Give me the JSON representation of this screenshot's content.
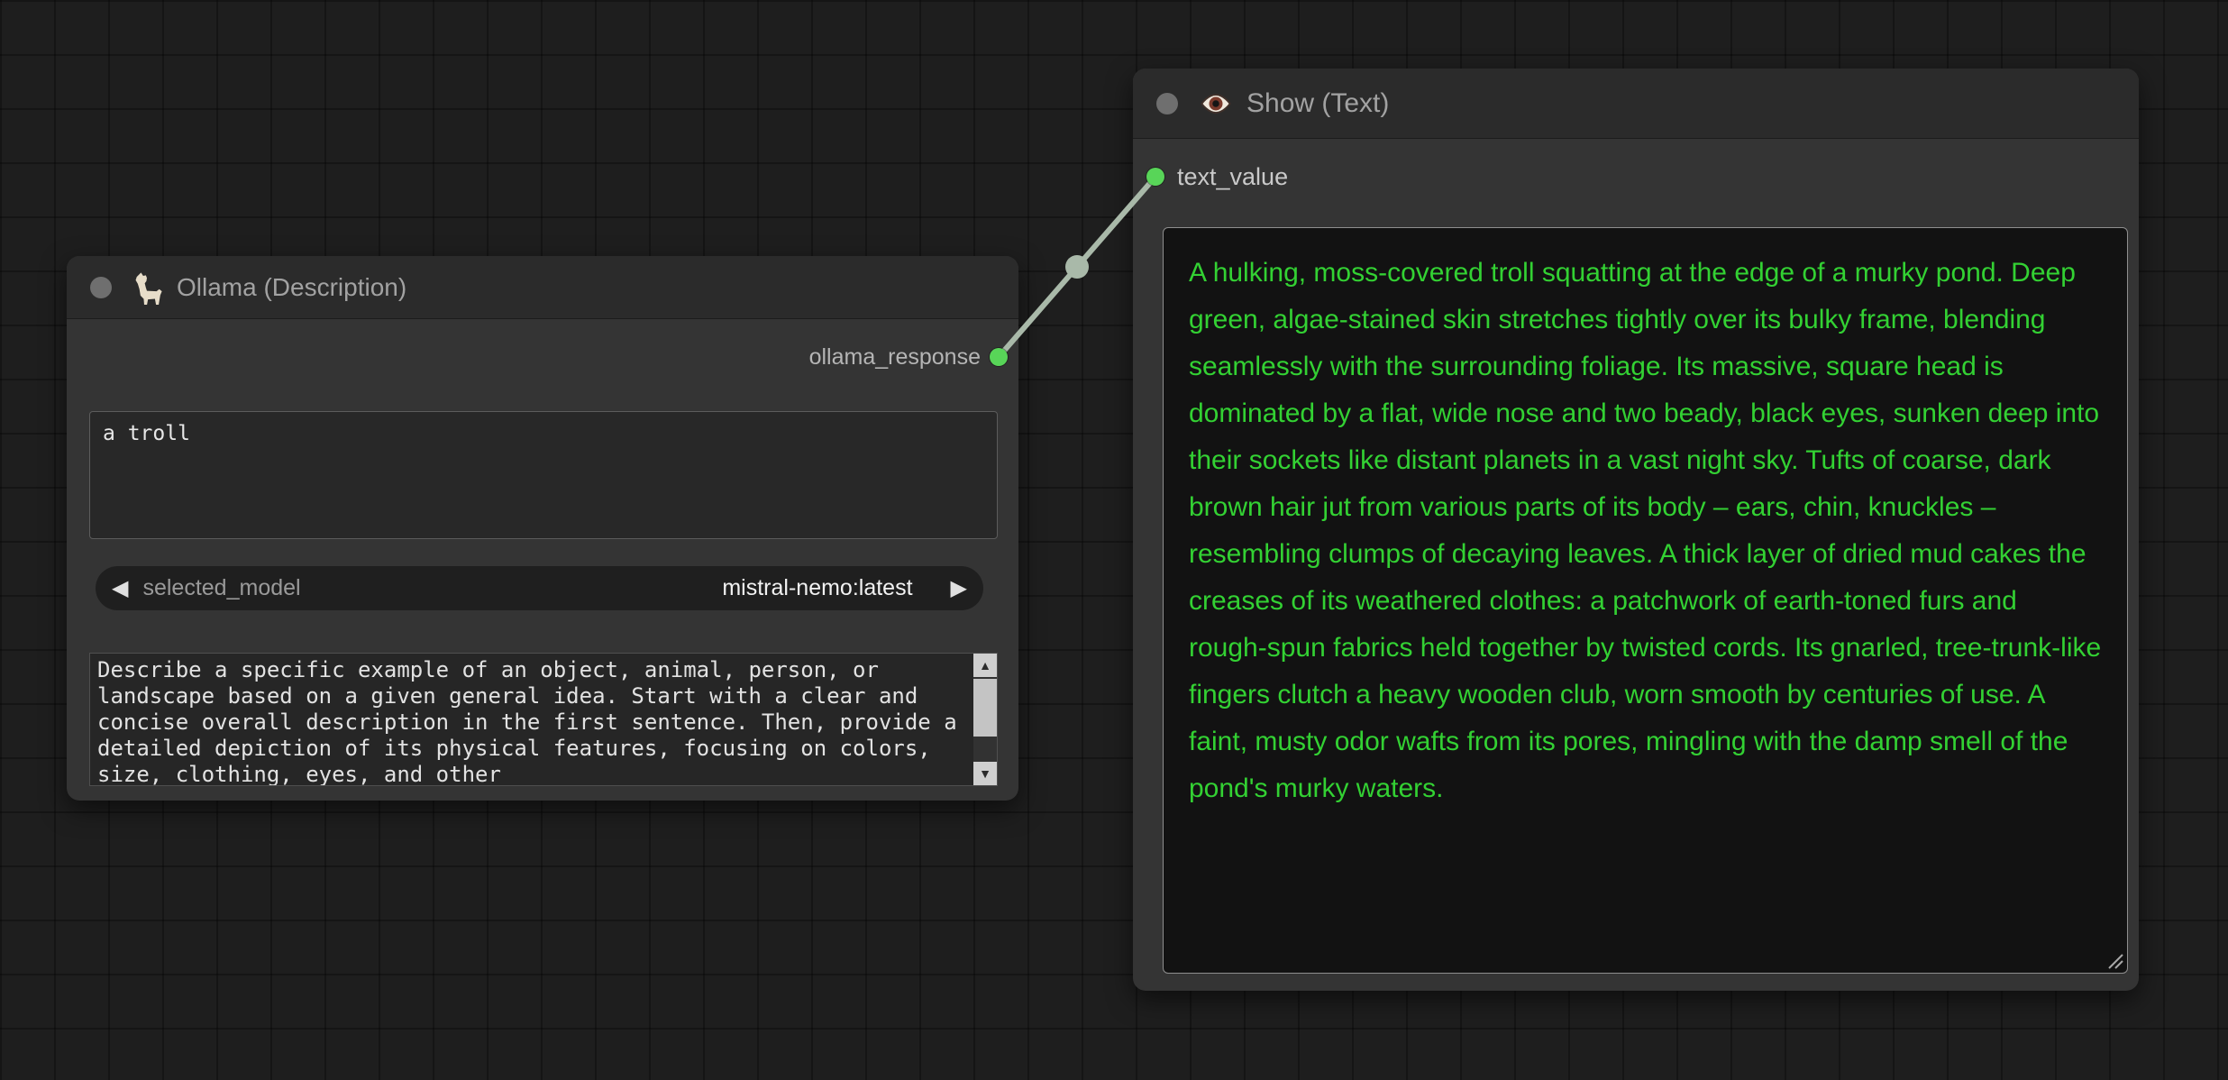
{
  "colors": {
    "slot_green": "#58d558",
    "link": "#a9b9a9",
    "show_text_green": "#33d133"
  },
  "icons": {
    "combo_prev": "◀",
    "combo_next": "▶",
    "scroll_up": "▲",
    "scroll_down": "▼",
    "llama": "llama-icon",
    "eye": "eye-icon"
  },
  "ollama_node": {
    "title": "Ollama (Description)",
    "output_slot_label": "ollama_response",
    "prompt_text": "a troll",
    "combo": {
      "label": "selected_model",
      "value": "mistral-nemo:latest"
    },
    "system_prompt": "Describe a specific example of an object, animal, person, or landscape based on a given general idea. Start with a clear and concise overall description in the first sentence. Then, provide a detailed depiction of its physical features, focusing on colors, size, clothing, eyes, and other"
  },
  "show_node": {
    "title": "Show (Text)",
    "input_slot_label": "text_value",
    "text_value": "A hulking, moss-covered troll squatting at the edge of a murky pond. Deep green, algae-stained skin stretches tightly over its bulky frame, blending seamlessly with the surrounding foliage. Its massive, square head is dominated by a flat, wide nose and two beady, black eyes, sunken deep into their sockets like distant planets in a vast night sky. Tufts of coarse, dark brown hair jut from various parts of its body – ears, chin, knuckles – resembling clumps of decaying leaves. A thick layer of dried mud cakes the creases of its weathered clothes: a patchwork of earth-toned furs and rough-spun fabrics held together by twisted cords. Its gnarled, tree-trunk-like fingers clutch a heavy wooden club, worn smooth by centuries of use. A faint, musty odor wafts from its pores, mingling with the damp smell of the pond's murky waters."
  }
}
